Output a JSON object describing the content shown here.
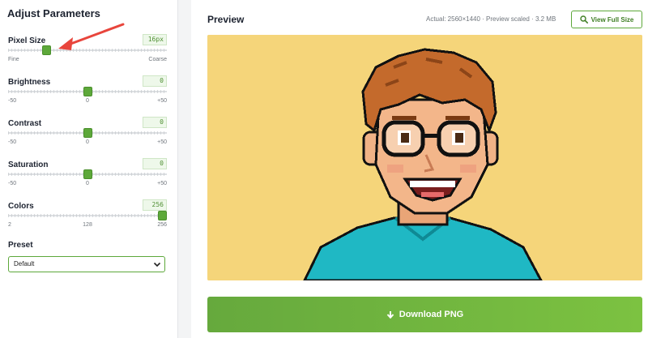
{
  "panel": {
    "title": "Adjust Parameters",
    "params": [
      {
        "label": "Pixel Size",
        "value": "16px",
        "min_label": "Fine",
        "mid_label": "",
        "max_label": "Coarse",
        "min": 1,
        "max": 64,
        "current": 16
      },
      {
        "label": "Brightness",
        "value": "0",
        "min_label": "-50",
        "mid_label": "0",
        "max_label": "+50",
        "min": -50,
        "max": 50,
        "current": 0
      },
      {
        "label": "Contrast",
        "value": "0",
        "min_label": "-50",
        "mid_label": "0",
        "max_label": "+50",
        "min": -50,
        "max": 50,
        "current": 0
      },
      {
        "label": "Saturation",
        "value": "0",
        "min_label": "-50",
        "mid_label": "0",
        "max_label": "+50",
        "min": -50,
        "max": 50,
        "current": 0
      },
      {
        "label": "Colors",
        "value": "256",
        "min_label": "2",
        "mid_label": "128",
        "max_label": "256",
        "min": 2,
        "max": 256,
        "current": 256
      }
    ],
    "preset": {
      "label": "Preset",
      "selected": "Default"
    }
  },
  "preview": {
    "title": "Preview",
    "meta": "Actual: 2560×1440 · Preview scaled · 3.2 MB",
    "view_full_label": "View Full Size",
    "download_label": "Download PNG"
  },
  "colors": {
    "accent": "#5da83a",
    "preview_bg": "#f5d57a",
    "annotation": "#e8453c"
  },
  "icons": {
    "search": "magnifier-icon",
    "download": "download-arrow-icon",
    "chevron": "chevron-down-icon"
  }
}
